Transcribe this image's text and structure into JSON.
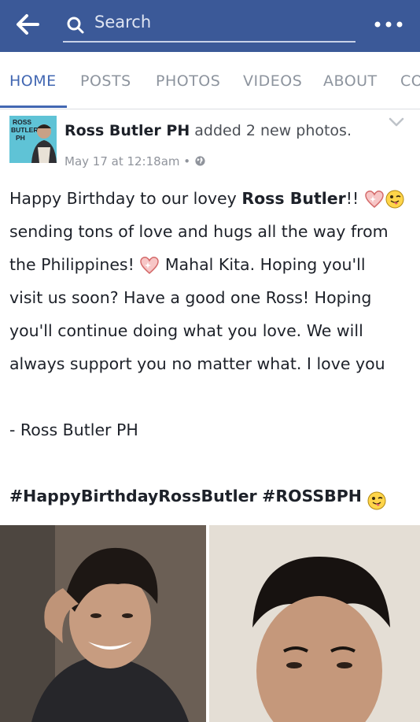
{
  "topbar": {
    "search_placeholder": "Search"
  },
  "tabs": [
    "HOME",
    "POSTS",
    "PHOTOS",
    "VIDEOS",
    "ABOUT",
    "CO"
  ],
  "post": {
    "author": "Ross Butler PH",
    "action": "added 2 new photos.",
    "timestamp": "May 17 at 12:18am",
    "avatar_text": "ROSS BUTLER PH",
    "lines": {
      "l1a": "Happy Birthday to our lovey ",
      "l1b": "Ross Butler",
      "l1c": "!!",
      "l2": "sending tons of love and hugs all the way from",
      "l3a": "the Philippines! ",
      "l3b": " Mahal Kita. Hoping you'll",
      "l4": "visit us soon? Have a good one Ross! Hoping",
      "l5": "you'll continue doing what you love. We will",
      "l6": "always support you no matter what. I love you",
      "l7": "- Ross Butler PH",
      "tag1": "#HappyBirthdayRossButler",
      "tag2": "#ROSSBPH"
    }
  },
  "colors": {
    "brand": "#3b5998",
    "tab_active": "#4267b2"
  }
}
